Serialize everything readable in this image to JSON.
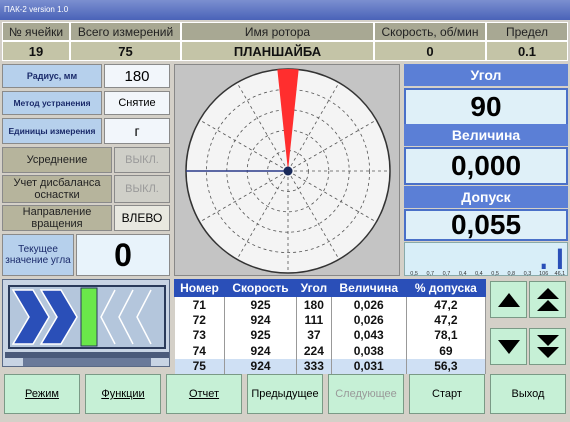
{
  "window": {
    "title": "ПАК-2 version 1.0"
  },
  "header": {
    "cols": [
      {
        "label": "№ ячейки",
        "value": "19"
      },
      {
        "label": "Всего измерений",
        "value": "75"
      },
      {
        "label": "Имя ротора",
        "value": "ПЛАНШАЙБА"
      },
      {
        "label": "Скорость, об/мин",
        "value": "0"
      },
      {
        "label": "Предел",
        "value": "0.1"
      }
    ]
  },
  "params": {
    "radius_label": "Радиус, мм",
    "radius_value": "180",
    "method_label": "Метод устранения",
    "method_value": "Снятие",
    "units_label": "Единицы измерения",
    "units_value": "г",
    "averaging_label": "Усреднение",
    "averaging_value": "ВЫКЛ.",
    "imbalance_label": "Учет дисбаланса оснастки",
    "imbalance_value": "ВЫКЛ.",
    "direction_label": "Направление вращения",
    "direction_value": "ВЛЕВО",
    "current_angle_label": "Текущее значение угла",
    "current_angle_value": "0"
  },
  "readouts": {
    "angle_label": "Угол",
    "angle_value": "90",
    "magnitude_label": "Величина",
    "magnitude_value": "0,000",
    "tolerance_label": "Допуск",
    "tolerance_value": "0,055"
  },
  "histogram": {
    "ticks": [
      "0,5",
      "0,7",
      "0,7",
      "0,4",
      "0,4",
      "0,5",
      "0,8",
      "0,3",
      "106",
      "46,1"
    ],
    "bars": [
      0,
      0,
      0,
      0,
      0,
      0,
      0,
      0,
      0.22,
      0.85
    ],
    "bar_color": "#2a4fb8"
  },
  "log_table": {
    "headers": [
      "Номер",
      "Скорость",
      "Угол",
      "Величина",
      "% допуска"
    ],
    "rows": [
      [
        "71",
        "925",
        "180",
        "0,026",
        "47,2"
      ],
      [
        "72",
        "924",
        "111",
        "0,026",
        "47,2"
      ],
      [
        "73",
        "925",
        "37",
        "0,043",
        "78,1"
      ],
      [
        "74",
        "924",
        "224",
        "0,038",
        "69"
      ],
      [
        "75",
        "924",
        "333",
        "0,031",
        "56,3"
      ]
    ],
    "selected_row": 4
  },
  "polar": {
    "marker_angle_deg": 90,
    "indicator_color": "#ff2e2e"
  },
  "icons": {
    "scroll_up": "triangle-up-icon",
    "scroll_page_up": "double-triangle-up-icon",
    "scroll_down": "triangle-down-icon",
    "scroll_page_down": "double-triangle-down-icon"
  },
  "footer": {
    "mode": "Режим",
    "functions": "Функции",
    "report": "Отчет",
    "previous": "Предыдущее",
    "next": "Следующее",
    "start": "Старт",
    "exit": "Выход"
  },
  "colors": {
    "accent": "#5b7fd6",
    "button_bg": "#c6f0d6",
    "indicator_green": "#6ae84a"
  }
}
